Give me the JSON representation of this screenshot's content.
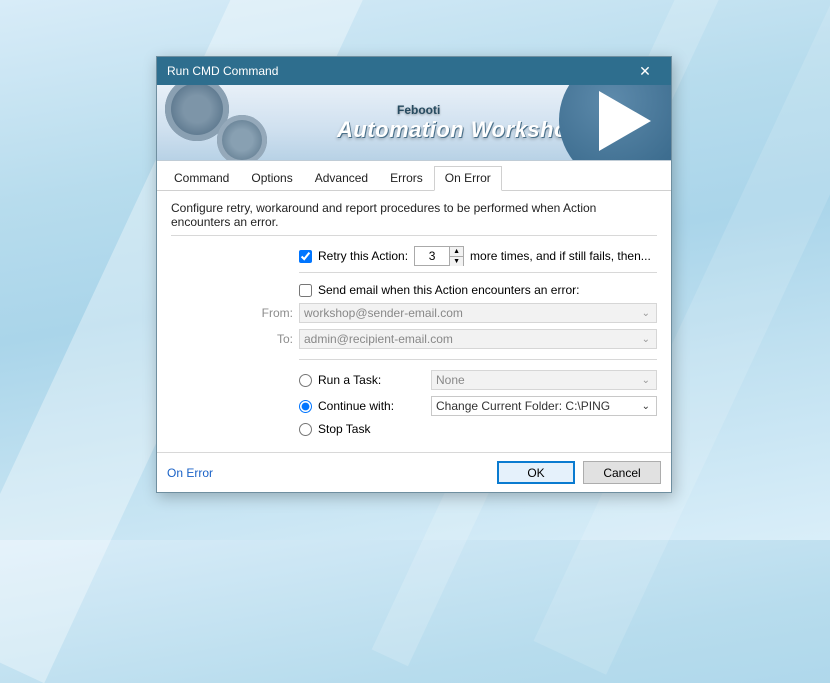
{
  "window": {
    "title": "Run CMD Command"
  },
  "banner": {
    "brand_small": "Febooti",
    "brand_big": "Automation Workshop"
  },
  "tabs": [
    "Command",
    "Options",
    "Advanced",
    "Errors",
    "On Error"
  ],
  "active_tab": 4,
  "description": "Configure retry, workaround and report procedures to be performed when Action encounters an error.",
  "retry": {
    "checkbox_label": "Retry this Action:",
    "checked": true,
    "count": "3",
    "suffix": "more times, and if still fails, then..."
  },
  "email": {
    "checkbox_label": "Send email when this Action encounters an error:",
    "checked": false,
    "from_label": "From:",
    "from_value": "workshop@sender-email.com",
    "to_label": "To:",
    "to_value": "admin@recipient-email.com"
  },
  "radios": {
    "run_task": {
      "label": "Run a Task:",
      "checked": false,
      "value": "None"
    },
    "continue_with": {
      "label": "Continue with:",
      "checked": true,
      "value": "Change Current Folder: C:\\PING"
    },
    "stop_task": {
      "label": "Stop Task",
      "checked": false
    }
  },
  "footer": {
    "help": "On Error",
    "ok": "OK",
    "cancel": "Cancel"
  }
}
